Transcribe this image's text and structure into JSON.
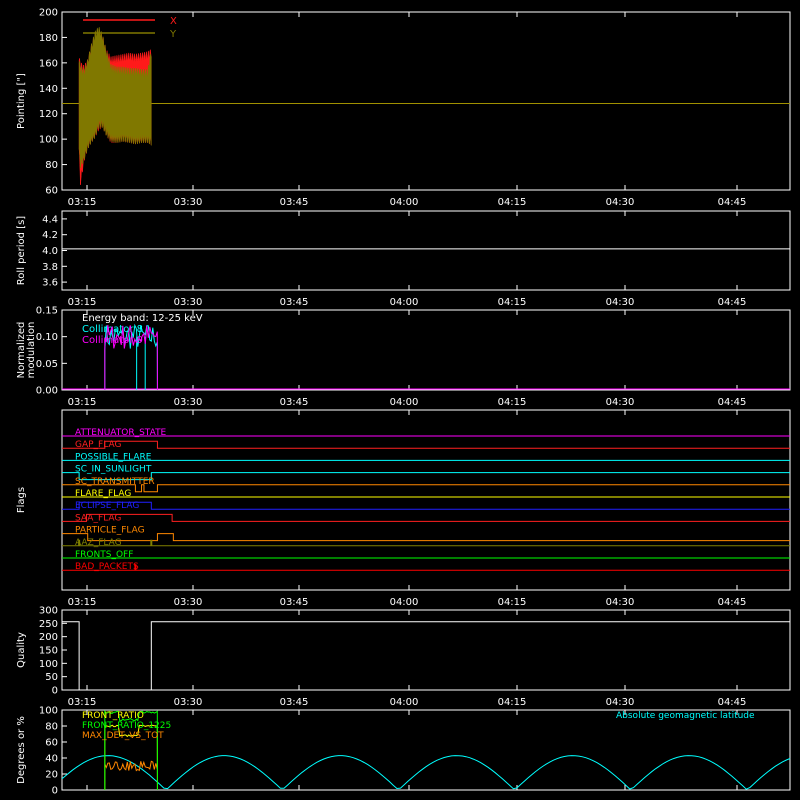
{
  "chart_data": [
    {
      "id": "pointing",
      "type": "line",
      "ylabel": "Pointing [\"]",
      "ylim": [
        60,
        200
      ],
      "yticks": [
        60,
        80,
        100,
        120,
        140,
        160,
        180,
        200
      ],
      "xlim": [
        195,
        790
      ],
      "xticks": [
        "03:15",
        "03:30",
        "03:45",
        "04:00",
        "04:15",
        "04:30",
        "04:45"
      ],
      "series": [
        {
          "name": "X",
          "color": "#ff1a1a",
          "baseline": 128,
          "envelope": {
            "t": [
              209,
              210,
              213,
              216,
              219,
              222,
              225,
              228,
              231,
              235,
              240,
              245,
              250,
              255,
              260,
              265,
              268
            ],
            "upper": [
              162,
              158,
              155,
              160,
              172,
              180,
              184,
              180,
              168,
              162,
              163,
              164,
              165,
              164,
              165,
              166,
              168
            ],
            "lower": [
              92,
              66,
              85,
              95,
              100,
              104,
              110,
              112,
              106,
              100,
              100,
              101,
              100,
              99,
              100,
              100,
              98
            ]
          }
        },
        {
          "name": "Y",
          "color": "#807800",
          "baseline": 128,
          "envelope": {
            "t": [
              209,
              210,
              213,
              216,
              219,
              222,
              225,
              228,
              231,
              235,
              240,
              245,
              250,
              255,
              260,
              265,
              268
            ],
            "upper": [
              160,
              155,
              152,
              160,
              172,
              182,
              186,
              180,
              168,
              156,
              154,
              154,
              153,
              153,
              152,
              152,
              168
            ],
            "lower": [
              92,
              80,
              86,
              95,
              100,
              104,
              112,
              112,
              106,
              101,
              100,
              101,
              100,
              99,
              100,
              100,
              98
            ]
          }
        }
      ]
    },
    {
      "id": "roll",
      "type": "line",
      "ylabel": "Roll period [s]",
      "ylim": [
        3.5,
        4.5
      ],
      "yticks": [
        3.6,
        3.8,
        4.0,
        4.2,
        4.4
      ],
      "xlim": [
        195,
        790
      ],
      "xticks": [
        "03:15",
        "03:30",
        "03:45",
        "04:00",
        "04:15",
        "04:30",
        "04:45"
      ],
      "series": [
        {
          "name": "",
          "color": "#ffffff",
          "x": [
            195,
            790
          ],
          "y": [
            4.02,
            4.02
          ]
        }
      ]
    },
    {
      "id": "modulation",
      "type": "line",
      "ylabel": "Normalized modulation",
      "ylim": [
        0.0,
        0.15
      ],
      "yticks": [
        0.0,
        0.05,
        0.1,
        0.15
      ],
      "xlim": [
        195,
        790
      ],
      "xticks": [
        "03:15",
        "03:30",
        "03:45",
        "04:00",
        "04:15",
        "04:30",
        "04:45"
      ],
      "legend": {
        "title": "Energy band: 12-25 keV"
      },
      "series": [
        {
          "name": "Collimator 8",
          "color": "#00ffff",
          "start": 230,
          "end": 273,
          "dropouts": [
            256,
            263
          ]
        },
        {
          "name": "Collimator 9",
          "color": "#ff00ff",
          "start": 230,
          "end": 273
        }
      ]
    },
    {
      "id": "flags",
      "type": "line",
      "ylabel": "Flags",
      "xlim": [
        195,
        790
      ],
      "xticks": [
        "03:15",
        "03:30",
        "03:45",
        "04:00",
        "04:15",
        "04:30",
        "04:45"
      ],
      "flags": [
        {
          "name": "ATTENUATOR_STATE",
          "color": "#ff00ff",
          "steps": []
        },
        {
          "name": "GAP_FLAG",
          "color": "#ff2020",
          "steps": [
            [
              230,
              -1
            ],
            [
              273,
              1
            ]
          ]
        },
        {
          "name": "POSSIBLE_FLARE",
          "color": "#00ffff",
          "steps": []
        },
        {
          "name": "SC_IN_SUNLIGHT",
          "color": "#00ffff",
          "steps": [
            [
              209,
              1
            ],
            [
              268,
              -1
            ]
          ]
        },
        {
          "name": "SC_TRANSMITTER",
          "color": "#ff8800",
          "steps": [
            [
              255,
              1
            ],
            [
              260,
              -1
            ],
            [
              262,
              1
            ],
            [
              273,
              -1
            ]
          ]
        },
        {
          "name": "FLARE_FLAG",
          "color": "#ffff00",
          "steps": []
        },
        {
          "name": "ECLIPSE_FLAG",
          "color": "#2020ff",
          "steps": [
            [
              209,
              -1
            ],
            [
              268,
              1
            ]
          ]
        },
        {
          "name": "SAA_FLAG",
          "color": "#ff2020",
          "steps": [
            [
              215,
              -1
            ],
            [
              285,
              1
            ]
          ]
        },
        {
          "name": "PARTICLE_FLAG",
          "color": "#ff8800",
          "steps": [
            [
              216,
              1
            ],
            [
              273,
              -1
            ],
            [
              286,
              1
            ]
          ]
        },
        {
          "name": "AAZ_FLAG",
          "color": "#808000",
          "spikes": [
            209,
            268
          ]
        },
        {
          "name": "FRONTS_OFF",
          "color": "#00ff00",
          "steps": []
        },
        {
          "name": "BAD_PACKETS",
          "color": "#ff0000",
          "spikes": [
            255
          ]
        }
      ]
    },
    {
      "id": "quality",
      "type": "line",
      "ylabel": "Quality",
      "ylim": [
        0,
        300
      ],
      "yticks": [
        0,
        50,
        100,
        150,
        200,
        250,
        300
      ],
      "xlim": [
        195,
        790
      ],
      "xticks": [
        "03:15",
        "03:30",
        "03:45",
        "04:00",
        "04:15",
        "04:30",
        "04:45"
      ],
      "series": [
        {
          "name": "",
          "color": "#ffffff",
          "x": [
            195,
            209,
            209,
            268,
            268,
            790
          ],
          "y": [
            256,
            256,
            0,
            0,
            256,
            256
          ]
        }
      ]
    },
    {
      "id": "ratios",
      "type": "line",
      "ylabel": "Degrees or %",
      "ylim": [
        0,
        100
      ],
      "yticks": [
        0,
        20,
        40,
        60,
        80,
        100
      ],
      "xlim": [
        195,
        790
      ],
      "xticks": [
        "03:15",
        "03:30",
        "03:45",
        "04:00",
        "04:15",
        "04:30",
        "04:45"
      ],
      "legend_right": "Absolute geomagnetic latitude",
      "series": [
        {
          "name": "FRONT_RATIO",
          "color": "#ffff00",
          "start": 230,
          "end": 273
        },
        {
          "name": "FRONT_RATIO_1225",
          "color": "#00ff00",
          "start": 230,
          "end": 273
        },
        {
          "name": "MAX_DET_VS_TOT",
          "color": "#ff8800",
          "start": 230,
          "end": 273
        },
        {
          "name": "Absolute geomagnetic latitude",
          "color": "#00ffff"
        }
      ]
    }
  ]
}
